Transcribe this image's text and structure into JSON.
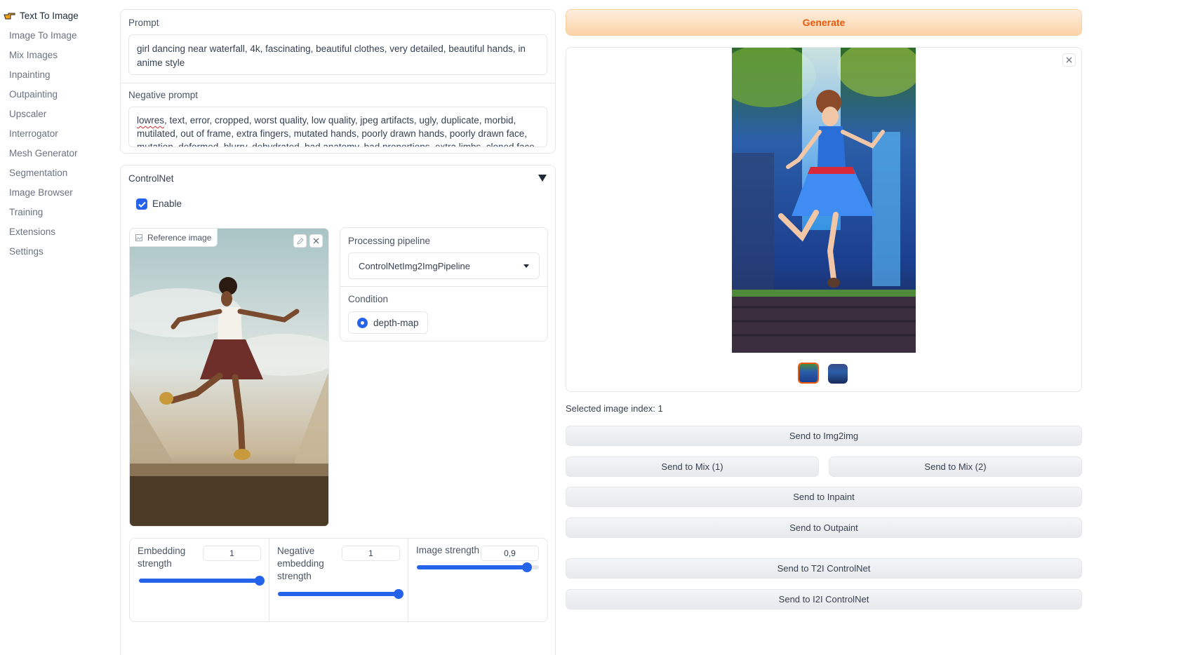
{
  "sidebar": {
    "items": [
      {
        "label": "Text To Image"
      },
      {
        "label": "Image To Image"
      },
      {
        "label": "Mix Images"
      },
      {
        "label": "Inpainting"
      },
      {
        "label": "Outpainting"
      },
      {
        "label": "Upscaler"
      },
      {
        "label": "Interrogator"
      },
      {
        "label": "Mesh Generator"
      },
      {
        "label": "Segmentation"
      },
      {
        "label": "Image Browser"
      },
      {
        "label": "Training"
      },
      {
        "label": "Extensions"
      },
      {
        "label": "Settings"
      }
    ]
  },
  "prompt": {
    "label": "Prompt",
    "value": "girl dancing near waterfall, 4k, fascinating, beautiful clothes, very detailed, beautiful hands, in anime style"
  },
  "negative_prompt": {
    "label": "Negative prompt",
    "first_word": "lowres",
    "rest": ", text, error, cropped, worst quality, low quality, jpeg artifacts, ugly, duplicate, morbid, mutilated, out of frame, extra fingers, mutated hands, poorly drawn hands, poorly drawn face, mutation, deformed, blurry, dehydrated, bad anatomy, bad proportions, extra limbs, cloned face, disfigured"
  },
  "controlnet": {
    "title": "ControlNet",
    "enable_label": "Enable",
    "enabled": true,
    "reference_label": "Reference image",
    "pipeline_label": "Processing pipeline",
    "pipeline_value": "ControlNetImg2ImgPipeline",
    "condition_label": "Condition",
    "condition_value": "depth-map",
    "embedding_strength": {
      "label_1": "Embedding",
      "label_2": "strength",
      "value": "1",
      "fraction": 1.0
    },
    "negative_embedding_strength": {
      "label_1": "Negative",
      "label_2": "embedding",
      "label_3": "strength",
      "value": "1",
      "fraction": 1.0
    },
    "image_strength": {
      "label": "Image strength",
      "value": "0,9",
      "fraction": 0.9
    }
  },
  "generate_label": "Generate",
  "selected_index_text": "Selected image index: 1",
  "actions": {
    "send_img2img": "Send to Img2img",
    "send_mix1": "Send to Mix (1)",
    "send_mix2": "Send to Mix (2)",
    "send_inpaint": "Send to Inpaint",
    "send_outpaint": "Send to Outpaint",
    "send_t2i_controlnet": "Send to T2I ControlNet",
    "send_i2i_controlnet": "Send to I2I ControlNet"
  },
  "icons": {
    "active_nav": "pointing-hand-icon",
    "close": "close-icon",
    "edit": "pencil-icon",
    "image": "image-icon",
    "dropdown": "caret-down-icon",
    "collapse": "triangle-down-icon"
  },
  "colors": {
    "accent": "#2563eb",
    "generate_text": "#ea580c",
    "generate_bg": "#fcd3a8"
  }
}
